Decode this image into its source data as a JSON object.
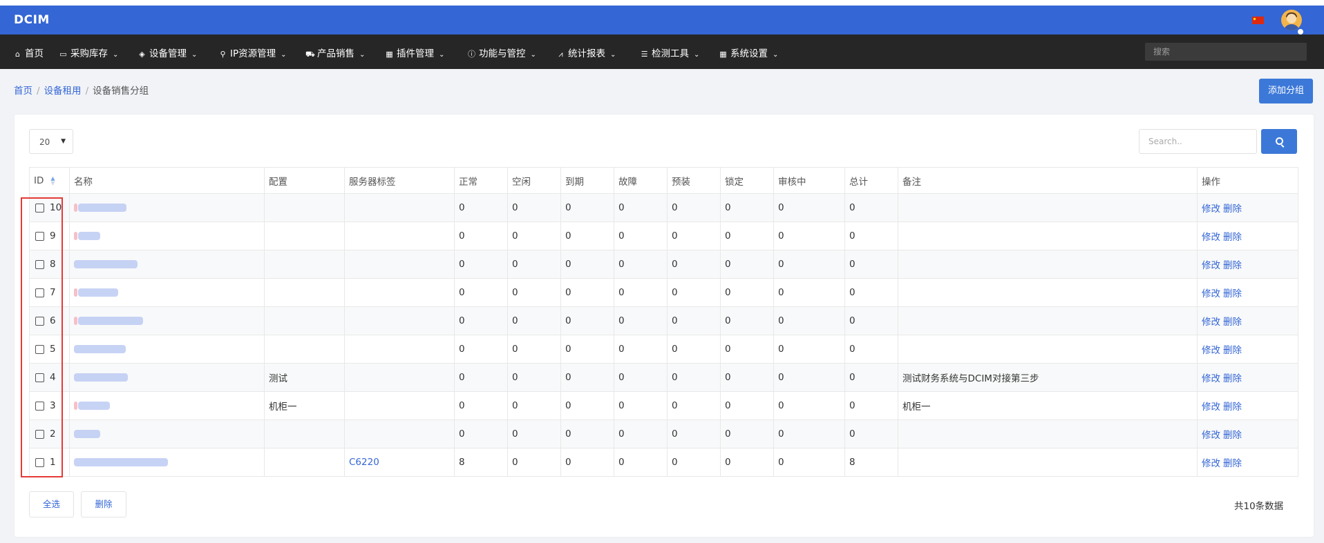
{
  "app": {
    "brand": "DCIM",
    "search_placeholder": "搜索"
  },
  "nav": [
    {
      "icon": "home-icon",
      "glyph": "⌂",
      "label": "首页",
      "dropdown": false
    },
    {
      "icon": "inbox-icon",
      "glyph": "▭",
      "label": "采购库存",
      "dropdown": true
    },
    {
      "icon": "cube-icon",
      "glyph": "◈",
      "label": "设备管理",
      "dropdown": true
    },
    {
      "icon": "map-marker-icon",
      "glyph": "⚲",
      "label": "IP资源管理",
      "dropdown": true
    },
    {
      "icon": "cart-icon",
      "glyph": "⛟",
      "label": "产品销售",
      "dropdown": true
    },
    {
      "icon": "table-icon",
      "glyph": "▦",
      "label": "插件管理",
      "dropdown": true
    },
    {
      "icon": "info-icon",
      "glyph": "ⓘ",
      "label": "功能与管控",
      "dropdown": true
    },
    {
      "icon": "chart-icon",
      "glyph": "⩘",
      "label": "统计报表",
      "dropdown": true
    },
    {
      "icon": "list-icon",
      "glyph": "☰",
      "label": "检测工具",
      "dropdown": true
    },
    {
      "icon": "grid-icon",
      "glyph": "▦",
      "label": "系统设置",
      "dropdown": true
    }
  ],
  "breadcrumb": {
    "home": "首页",
    "parent": "设备租用",
    "current": "设备销售分组"
  },
  "add_button": "添加分组",
  "page_size": "20",
  "table_search_placeholder": "Search..",
  "columns": [
    "ID",
    "名称",
    "配置",
    "服务器标签",
    "正常",
    "空闲",
    "到期",
    "故障",
    "预装",
    "锁定",
    "审核中",
    "总计",
    "备注",
    "操作"
  ],
  "rows": [
    {
      "id": "10",
      "config": "",
      "tag": "",
      "normal": "0",
      "idle": "0",
      "expired": "0",
      "fault": "0",
      "preinstall": "0",
      "locked": "0",
      "review": "0",
      "total": "0",
      "note": "",
      "edit": "修改",
      "delete": "删除"
    },
    {
      "id": "9",
      "config": "",
      "tag": "",
      "normal": "0",
      "idle": "0",
      "expired": "0",
      "fault": "0",
      "preinstall": "0",
      "locked": "0",
      "review": "0",
      "total": "0",
      "note": "",
      "edit": "修改",
      "delete": "删除"
    },
    {
      "id": "8",
      "config": "",
      "tag": "",
      "normal": "0",
      "idle": "0",
      "expired": "0",
      "fault": "0",
      "preinstall": "0",
      "locked": "0",
      "review": "0",
      "total": "0",
      "note": "",
      "edit": "修改",
      "delete": "删除"
    },
    {
      "id": "7",
      "config": "",
      "tag": "",
      "normal": "0",
      "idle": "0",
      "expired": "0",
      "fault": "0",
      "preinstall": "0",
      "locked": "0",
      "review": "0",
      "total": "0",
      "note": "",
      "edit": "修改",
      "delete": "删除"
    },
    {
      "id": "6",
      "config": "",
      "tag": "",
      "normal": "0",
      "idle": "0",
      "expired": "0",
      "fault": "0",
      "preinstall": "0",
      "locked": "0",
      "review": "0",
      "total": "0",
      "note": "",
      "edit": "修改",
      "delete": "删除"
    },
    {
      "id": "5",
      "config": "",
      "tag": "",
      "normal": "0",
      "idle": "0",
      "expired": "0",
      "fault": "0",
      "preinstall": "0",
      "locked": "0",
      "review": "0",
      "total": "0",
      "note": "",
      "edit": "修改",
      "delete": "删除"
    },
    {
      "id": "4",
      "config": "测试",
      "tag": "",
      "normal": "0",
      "idle": "0",
      "expired": "0",
      "fault": "0",
      "preinstall": "0",
      "locked": "0",
      "review": "0",
      "total": "0",
      "note": "测试财务系统与DCIM对接第三步",
      "edit": "修改",
      "delete": "删除"
    },
    {
      "id": "3",
      "config": "机柜一",
      "tag": "",
      "normal": "0",
      "idle": "0",
      "expired": "0",
      "fault": "0",
      "preinstall": "0",
      "locked": "0",
      "review": "0",
      "total": "0",
      "note": "机柜一",
      "edit": "修改",
      "delete": "删除"
    },
    {
      "id": "2",
      "config": "",
      "tag": "",
      "normal": "0",
      "idle": "0",
      "expired": "0",
      "fault": "0",
      "preinstall": "0",
      "locked": "0",
      "review": "0",
      "total": "0",
      "note": "",
      "edit": "修改",
      "delete": "删除"
    },
    {
      "id": "1",
      "config": "",
      "tag": "C6220",
      "normal": "8",
      "idle": "0",
      "expired": "0",
      "fault": "0",
      "preinstall": "0",
      "locked": "0",
      "review": "0",
      "total": "8",
      "note": "",
      "edit": "修改",
      "delete": "删除"
    }
  ],
  "footer": {
    "select_all": "全选",
    "delete": "删除",
    "total_text": "共10条数据"
  },
  "colors": {
    "header_blue": "#3466d5",
    "nav_dark": "#262626",
    "primary_button": "#3c78d8",
    "selection_outline": "#e53935"
  }
}
